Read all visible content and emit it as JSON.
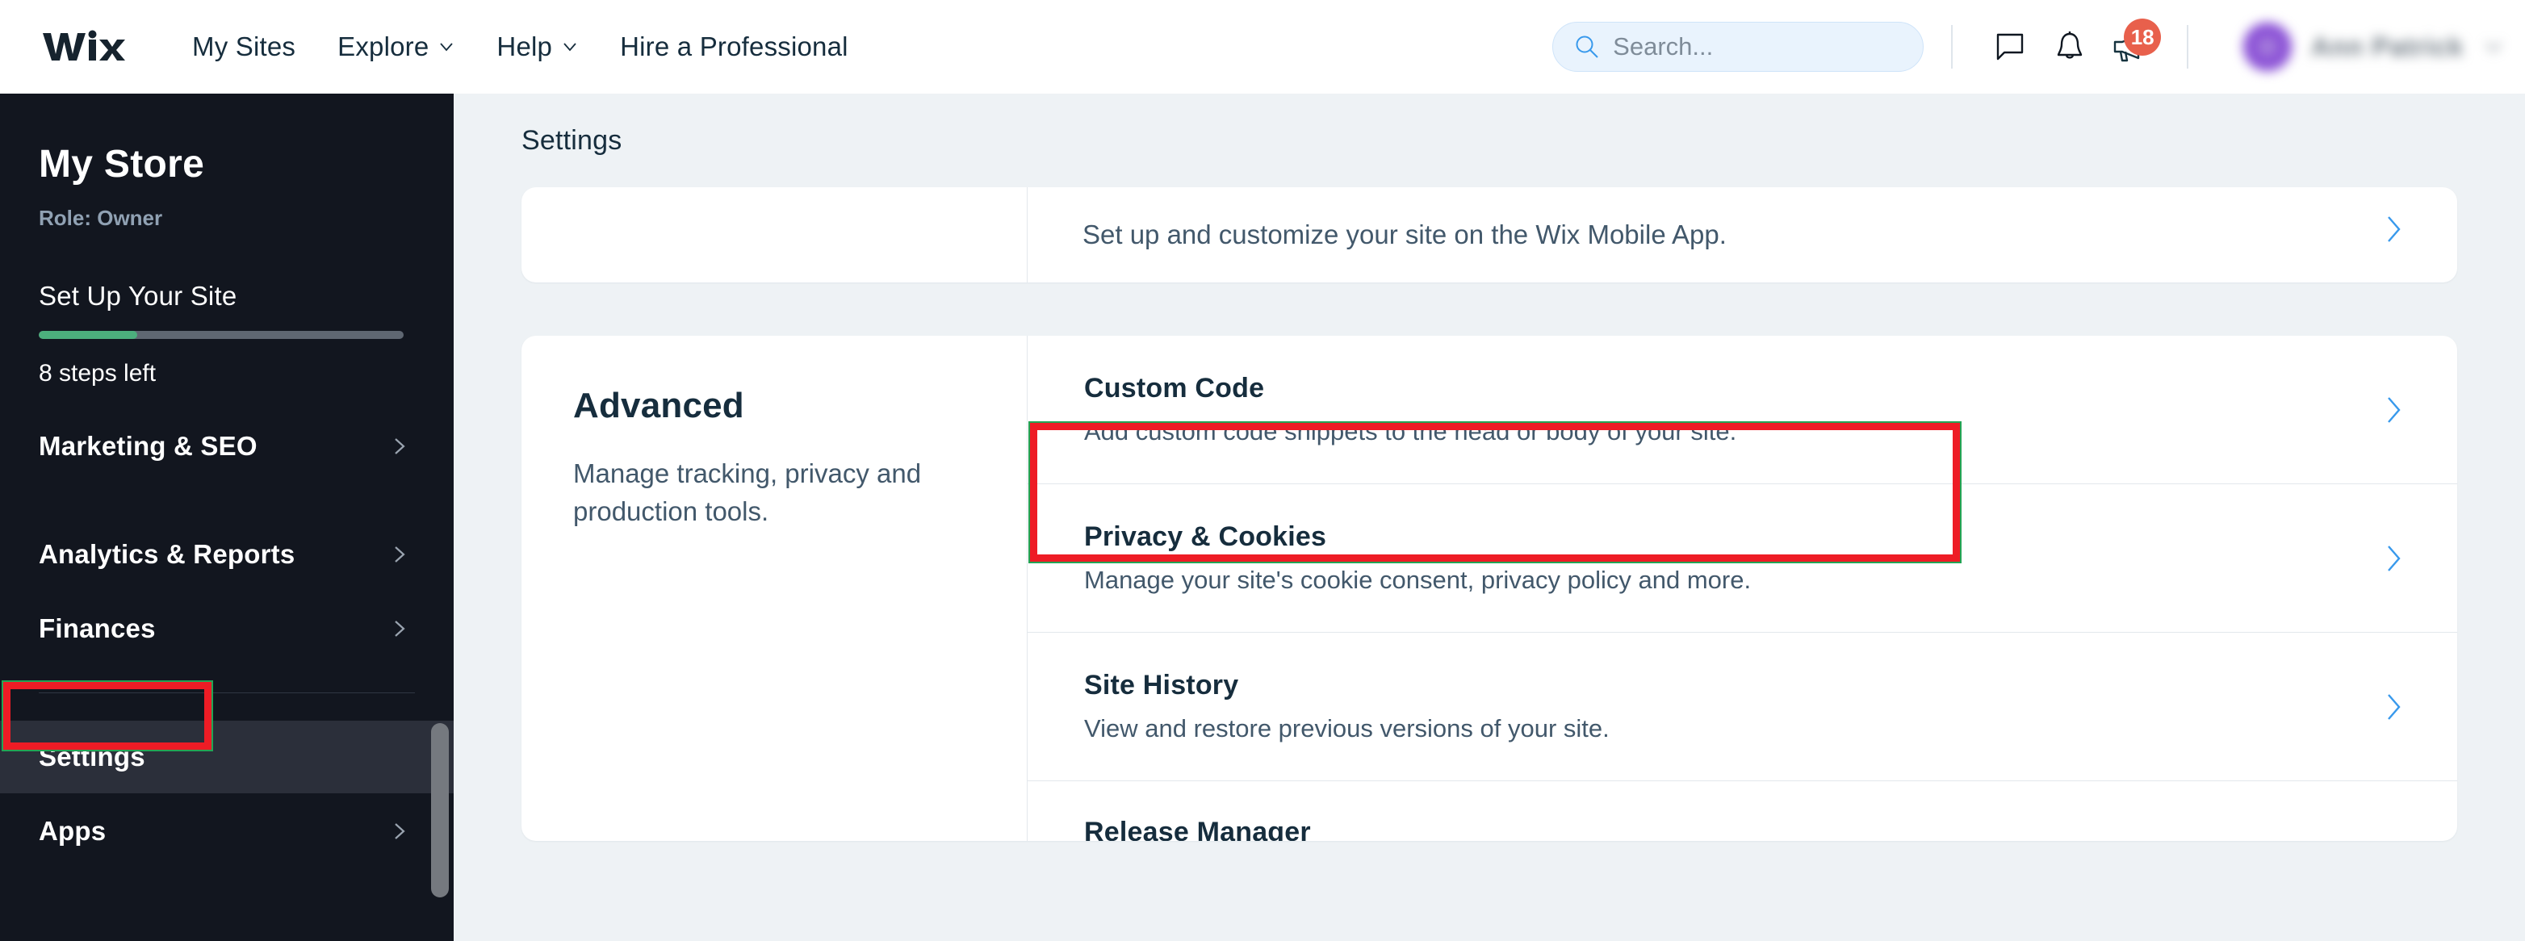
{
  "topnav": {
    "logo": "wix-logo",
    "items": [
      {
        "label": "My Sites",
        "has_caret": false
      },
      {
        "label": "Explore",
        "has_caret": true
      },
      {
        "label": "Help",
        "has_caret": true
      },
      {
        "label": "Hire a Professional",
        "has_caret": false
      }
    ],
    "search": {
      "placeholder": "Search...",
      "value": ""
    },
    "icons": [
      {
        "name": "chat-icon"
      },
      {
        "name": "bell-icon"
      },
      {
        "name": "megaphone-icon",
        "badge": "18"
      }
    ],
    "user": {
      "name": "Ann Patrick"
    }
  },
  "sidebar": {
    "store_title": "My Store",
    "role": "Role: Owner",
    "setup_title": "Set Up Your Site",
    "progress_percent": 27,
    "steps_left": "8 steps left",
    "items": [
      {
        "label": "Marketing & SEO",
        "has_chevron": true,
        "active": false
      },
      {
        "label": "Analytics & Reports",
        "has_chevron": true,
        "active": false
      },
      {
        "label": "Finances",
        "has_chevron": true,
        "active": false
      },
      {
        "label": "Settings",
        "has_chevron": false,
        "active": true
      },
      {
        "label": "Apps",
        "has_chevron": true,
        "active": false
      }
    ]
  },
  "main": {
    "header_title": "Settings",
    "mobile_card": {
      "description": "Set up and customize your site on the Wix Mobile App."
    },
    "advanced_card": {
      "title": "Advanced",
      "description": "Manage tracking, privacy and production tools.",
      "rows": [
        {
          "title": "Custom Code",
          "description": "Add custom code snippets to the head or body of your site.",
          "highlighted": true
        },
        {
          "title": "Privacy & Cookies",
          "description": "Manage your site's cookie consent, privacy policy and more.",
          "highlighted": false
        },
        {
          "title": "Site History",
          "description": "View and restore previous versions of your site.",
          "highlighted": false
        },
        {
          "title": "Release Manager",
          "description": "",
          "highlighted": false
        }
      ]
    }
  },
  "annotations": {
    "highlight_color": "#ee1c25",
    "outline_color": "#23a455"
  }
}
